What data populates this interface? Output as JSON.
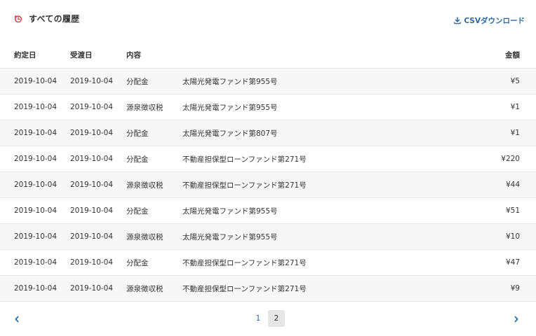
{
  "header": {
    "title": "すべての履歴",
    "csv_label": "CSVダウンロード"
  },
  "colors": {
    "accent": "#2c6aa0",
    "history_icon": "#d9363e",
    "row_alt": "#f7f7f7",
    "active_page_bg": "#e6e6e6"
  },
  "icons": {
    "title": "history-clock-icon",
    "csv": "download-icon",
    "prev": "chevron-left-icon",
    "next": "chevron-right-icon"
  },
  "table": {
    "columns": [
      "約定日",
      "受渡日",
      "内容",
      "",
      "金額"
    ],
    "rows": [
      {
        "trade_date": "2019-10-04",
        "settle_date": "2019-10-04",
        "type": "分配金",
        "fund": "太陽光発電ファンド第955号",
        "amount": "¥5"
      },
      {
        "trade_date": "2019-10-04",
        "settle_date": "2019-10-04",
        "type": "源泉徴収税",
        "fund": "太陽光発電ファンド第955号",
        "amount": "¥1"
      },
      {
        "trade_date": "2019-10-04",
        "settle_date": "2019-10-04",
        "type": "分配金",
        "fund": "太陽光発電ファンド第807号",
        "amount": "¥1"
      },
      {
        "trade_date": "2019-10-04",
        "settle_date": "2019-10-04",
        "type": "分配金",
        "fund": "不動産担保型ローンファンド第271号",
        "amount": "¥220"
      },
      {
        "trade_date": "2019-10-04",
        "settle_date": "2019-10-04",
        "type": "源泉徴収税",
        "fund": "不動産担保型ローンファンド第271号",
        "amount": "¥44"
      },
      {
        "trade_date": "2019-10-04",
        "settle_date": "2019-10-04",
        "type": "分配金",
        "fund": "太陽光発電ファンド第955号",
        "amount": "¥51"
      },
      {
        "trade_date": "2019-10-04",
        "settle_date": "2019-10-04",
        "type": "源泉徴収税",
        "fund": "太陽光発電ファンド第955号",
        "amount": "¥10"
      },
      {
        "trade_date": "2019-10-04",
        "settle_date": "2019-10-04",
        "type": "分配金",
        "fund": "不動産担保型ローンファンド第271号",
        "amount": "¥47"
      },
      {
        "trade_date": "2019-10-04",
        "settle_date": "2019-10-04",
        "type": "源泉徴収税",
        "fund": "不動産担保型ローンファンド第271号",
        "amount": "¥9"
      }
    ]
  },
  "pagination": {
    "pages": [
      "1",
      "2"
    ],
    "current": "2"
  }
}
